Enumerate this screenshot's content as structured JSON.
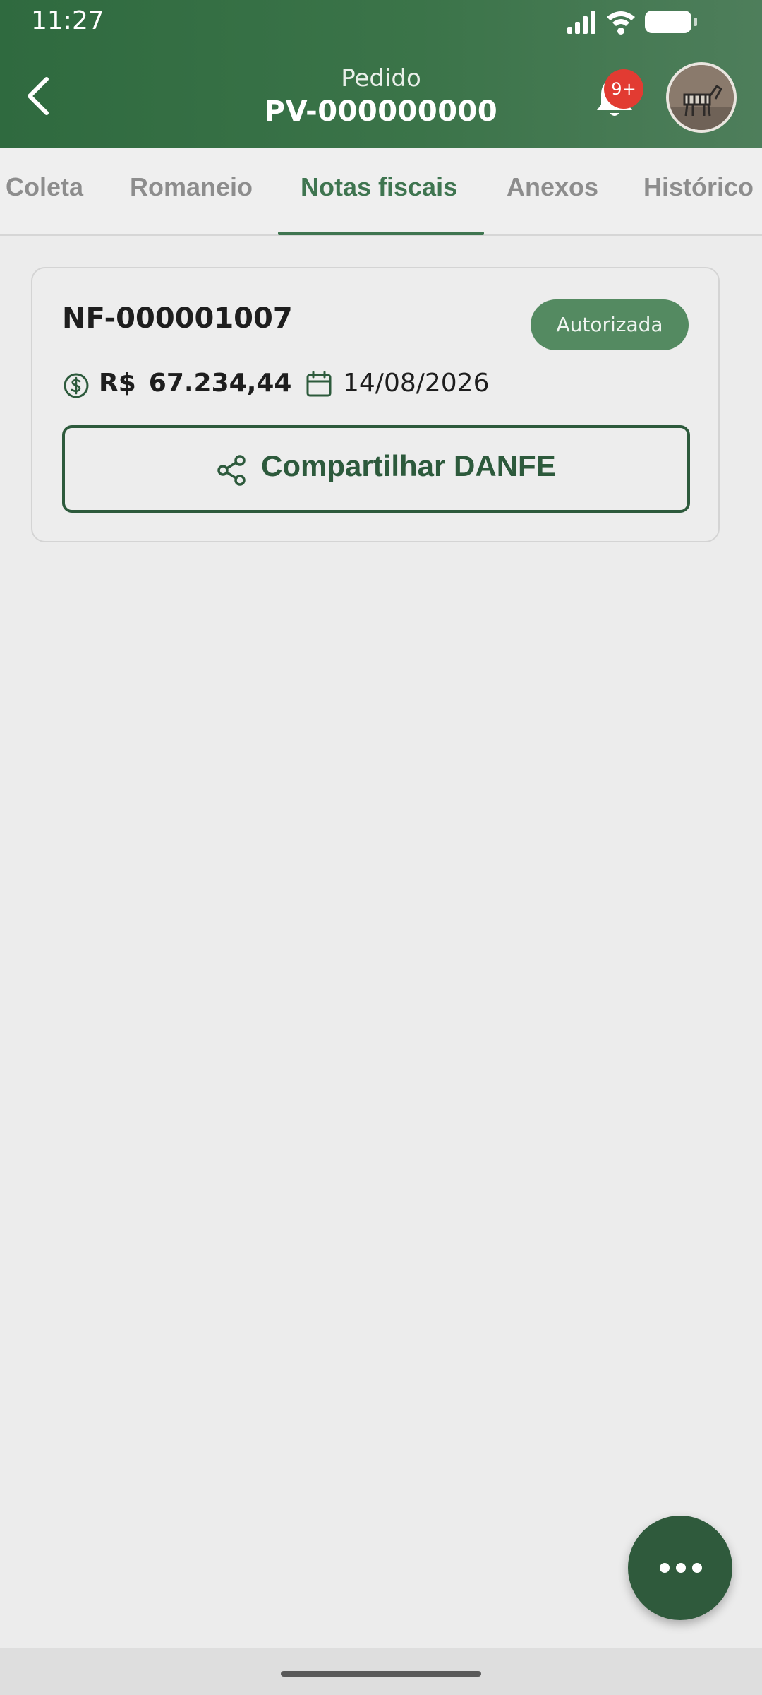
{
  "status_bar": {
    "time": "11:27"
  },
  "header": {
    "subtitle": "Pedido",
    "title": "PV-000000000",
    "notification_badge": "9+",
    "back_icon": "chevron-left-icon",
    "bell_icon": "bell-icon"
  },
  "tabs": [
    {
      "label": "Coleta"
    },
    {
      "label": "Romaneio"
    },
    {
      "label": "Notas fiscais",
      "active": true
    },
    {
      "label": "Anexos"
    },
    {
      "label": "Histórico"
    }
  ],
  "invoice": {
    "number": "NF-000001007",
    "status": "Autorizada",
    "currency": "R$",
    "amount": "67.234,44",
    "date": "14/08/2026",
    "share_label": "Compartilhar DANFE"
  },
  "colors": {
    "brand_green": "#3f7550",
    "dark_green": "#2d5a3c",
    "status_green": "#548a61",
    "badge_red": "#e23b32"
  }
}
